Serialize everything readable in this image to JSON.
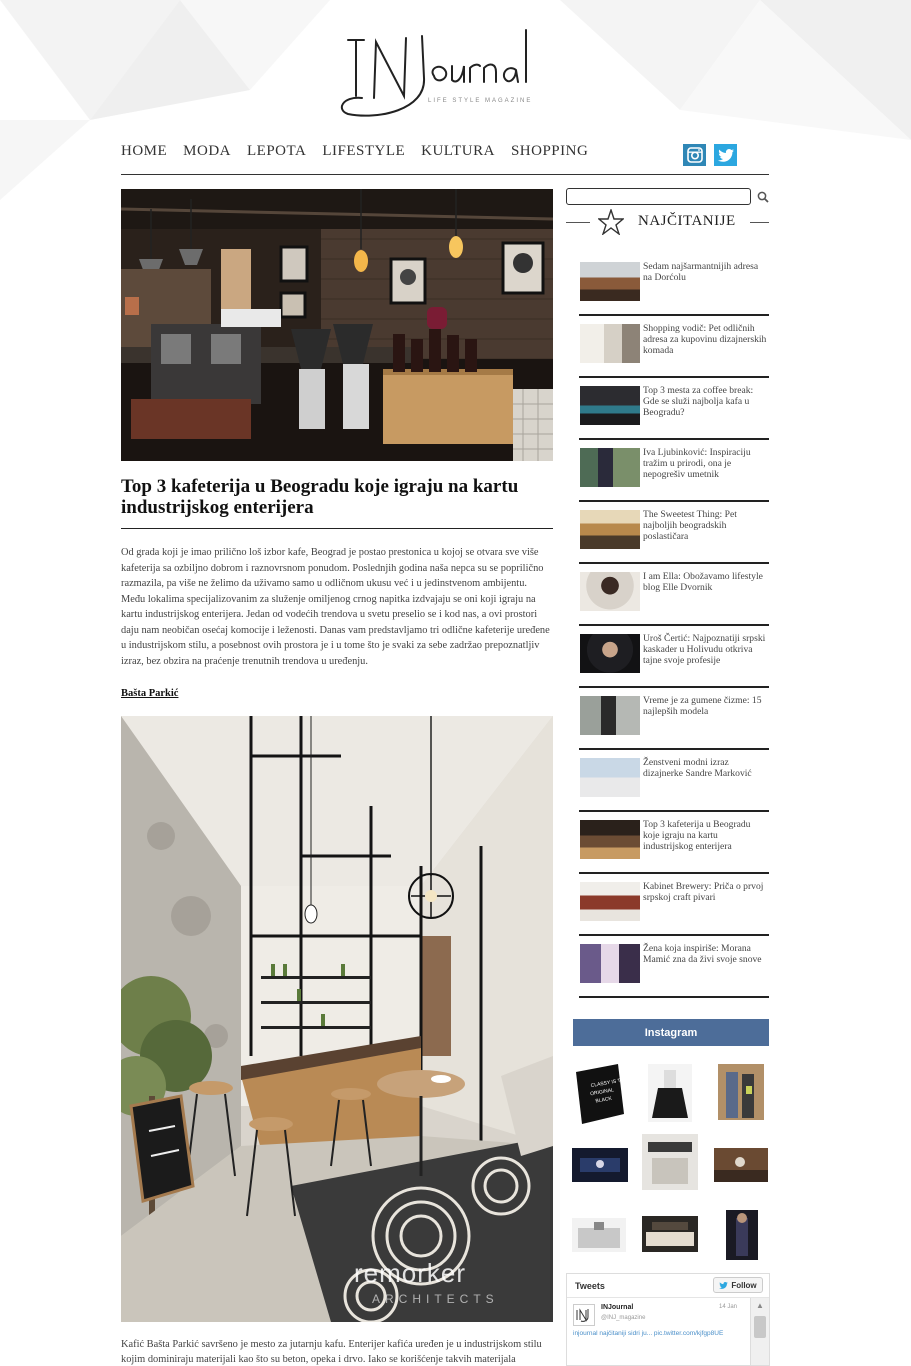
{
  "header": {
    "logo_text": "IN Journal",
    "tagline": "LIFE STYLE MAGAZINE"
  },
  "nav": {
    "items": [
      "HOME",
      "MODA",
      "LEPOTA",
      "LIFESTYLE",
      "KULTURA",
      "SHOPPING"
    ]
  },
  "social": {
    "icons": [
      "facebook-icon",
      "twitter-icon",
      "instagram-icon"
    ],
    "colors": {
      "facebook": "#3b5998",
      "twitter": "#2ca7e0",
      "instagram": "#2f87b6"
    }
  },
  "article": {
    "title": "Top 3 kafeterija u Beogradu koje igraju na kartu industrijskog enterijera",
    "intro": "Od grada koji je imao prilično loš izbor kafe, Beograd je postao prestonica u kojoj se otvara sve više kafeterija sa ozbiljno dobrom i raznovrsnom ponudom. Poslednjih godina naša nepca su se popriličnо razmazila, pa više ne želimo da uživamo samo u odličnom ukusu već i u jedinstvenom ambijentu. Među lokalima specijalizovanim za služenje omiljenog crnog napitka izdvajaju se oni koji igraju na kartu industrijskog enterijera. Jedan od vodećih trendova u svetu preselio se i kod nas, a ovi prostori daju nam neobičan osećaj komocije i leženosti. Danas vam predstavljamo tri odlične kafeterije uređene u industrijskom stilu, a posebnost ovih prostora je i u tome što je svaki za sebe zadržao prepoznatljiv izraz, bez obzira na praćenje trenutnih trendova u uređenju.",
    "subhead": "Bašta Parkić",
    "watermark": "remorker",
    "watermark_sub": "ARCHITECTS",
    "body_2": "Kafić Bašta Parkić savršeno je mesto za jutarnju kafu. Enterijer kafića uređen je u industrijskom stilu kojim dominiraju materijali kao što su beton, opeka i drvo. Iako se korišćenje takvih materijala"
  },
  "sidebar": {
    "search_placeholder": "",
    "popular_heading": "NAJČITANIJE",
    "popular": [
      "Sedam najšarmantnijih adresa na Dorćolu",
      "Shopping vodič: Pet odličnih adresa za kupovinu dizajnerskih komada",
      "Top 3 mesta za coffee break: Gde se služi najbolja kafa u Beogradu?",
      "Iva Ljubinković: Inspiraciju tražim u prirodi, ona je nepogrešiv umetnik",
      "The Sweetest Thing: Pet najboljih beogradskih poslastičara",
      "I am Ella: Obožavamo lifestyle blog Elle Dvornik",
      "Uroš Čertić: Najpoznatiji srpski kaskader u Holivudu otkriva tajne svoje profesije",
      "Vreme je za gumene čizme: 15 najlepših modela",
      "Ženstveni modni izraz dizajnerke Sandre Marković",
      "Top 3 kafeterija u Beogradu koje igraju na kartu industrijskog enterijera",
      "Kabinet Brewery: Priča o prvoj srpskoj craft pivari",
      "Žena koja inspiriše: Morana Mamić zna da živi svoje snove"
    ],
    "instagram_heading": "Instagram",
    "instagram_box_text": "CLASSY IS THE ORIGINAL BLACK",
    "tweets": {
      "title": "Tweets",
      "follow_label": "Follow",
      "name": "INJournal",
      "handle": "@INJ_magazine",
      "date": "14 Jan",
      "text": "injournal najčitaniji sidri ju... pic.twitter.com/kjfgp8UE"
    }
  }
}
